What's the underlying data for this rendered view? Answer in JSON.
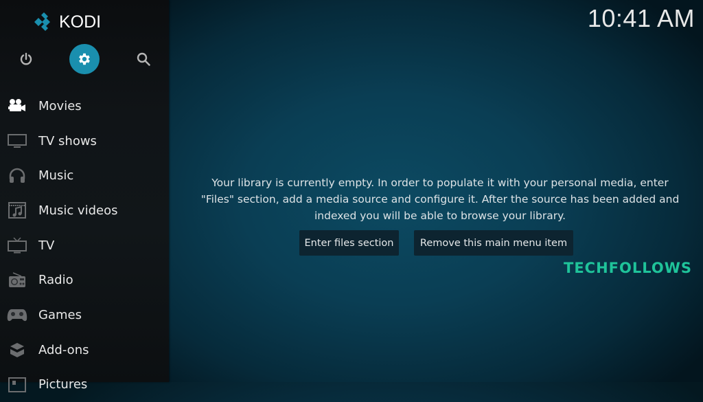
{
  "app": {
    "name": "KODI",
    "brand_color": "#1a8fae"
  },
  "clock": {
    "time": "10:41 AM"
  },
  "top_icons": [
    {
      "name": "power-icon",
      "label": "Power"
    },
    {
      "name": "settings-icon",
      "label": "Settings",
      "active": true
    },
    {
      "name": "search-icon",
      "label": "Search"
    }
  ],
  "menu": {
    "items": [
      {
        "label": "Movies",
        "icon": "movie-camera-icon",
        "active": true
      },
      {
        "label": "TV shows",
        "icon": "monitor-icon"
      },
      {
        "label": "Music",
        "icon": "headphones-icon"
      },
      {
        "label": "Music videos",
        "icon": "music-video-icon"
      },
      {
        "label": "TV",
        "icon": "tv-antenna-icon"
      },
      {
        "label": "Radio",
        "icon": "radio-icon"
      },
      {
        "label": "Games",
        "icon": "gamepad-icon"
      },
      {
        "label": "Add-ons",
        "icon": "open-box-icon"
      },
      {
        "label": "Pictures",
        "icon": "picture-icon"
      }
    ]
  },
  "content": {
    "message_lines": [
      "Your library is currently empty. In order to populate it with your personal media, enter",
      "\"Files\" section, add a media source and configure it. After the source has been added and",
      "indexed you will be able to browse your library."
    ],
    "buttons": {
      "enter_files": "Enter files section",
      "remove_item": "Remove this main menu item"
    }
  },
  "watermark": {
    "text": "TECHFOLLOWS",
    "color": "#1fc39a"
  }
}
